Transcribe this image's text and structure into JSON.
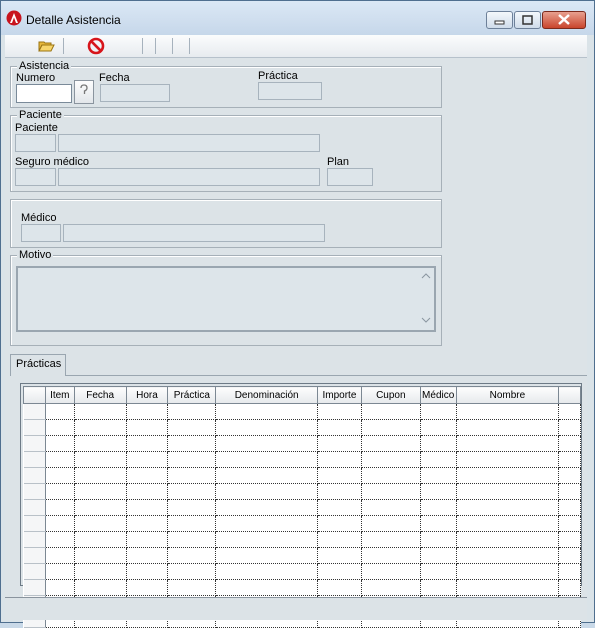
{
  "window": {
    "title": "Detalle Asistencia"
  },
  "toolbar": {
    "open_icon": "folder-open-icon",
    "cancel_icon": "no-entry-icon"
  },
  "asistencia": {
    "legend": "Asistencia",
    "numero_label": "Numero",
    "fecha_label": "Fecha",
    "practica_label": "Práctica",
    "numero_value": "",
    "fecha_value": "",
    "practica_value": ""
  },
  "paciente": {
    "legend": "Paciente",
    "paciente_label": "Paciente",
    "seguro_label": "Seguro médico",
    "plan_label": "Plan"
  },
  "medico": {
    "label": "Médico"
  },
  "motivo": {
    "legend": "Motivo",
    "value": ""
  },
  "tabs": [
    {
      "label": "Prácticas"
    }
  ],
  "grid": {
    "columns": [
      "",
      "Item",
      "Fecha",
      "Hora",
      "Práctica",
      "Denominación",
      "Importe",
      "Cupon",
      "Médico",
      "Nombre",
      ""
    ],
    "row_count": 14
  }
}
